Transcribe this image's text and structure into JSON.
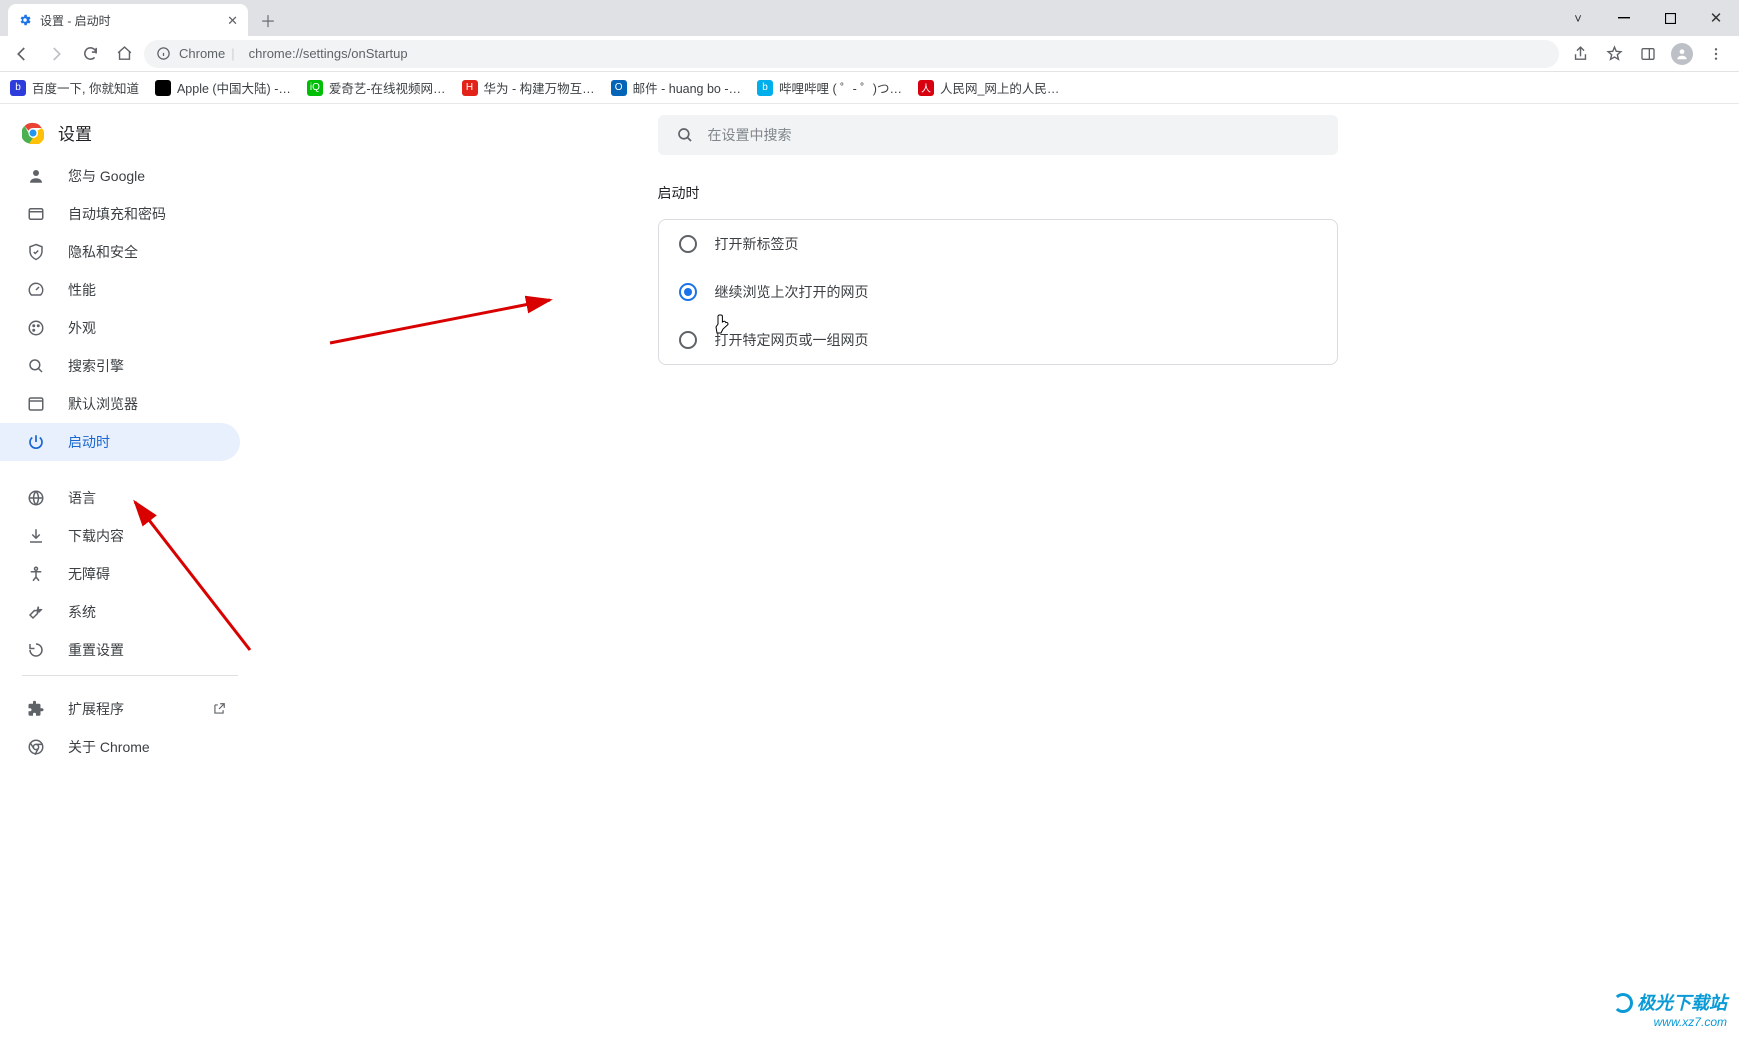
{
  "window": {
    "tab_title": "设置 - 启动时",
    "chrome_label": "Chrome",
    "url": "chrome://settings/onStartup"
  },
  "bookmarks": [
    {
      "label": "百度一下, 你就知道"
    },
    {
      "label": "Apple (中国大陆) -…"
    },
    {
      "label": "爱奇艺-在线视频网…"
    },
    {
      "label": "华为 - 构建万物互…"
    },
    {
      "label": "邮件 - huang bo -…"
    },
    {
      "label": "哔哩哔哩 ( ゜- ゜)つ…"
    },
    {
      "label": "人民网_网上的人民…"
    }
  ],
  "sidebar_title": "设置",
  "search_placeholder": "在设置中搜索",
  "sidebar": [
    {
      "id": "you-and-google",
      "label": "您与 Google",
      "icon": "person"
    },
    {
      "id": "autofill",
      "label": "自动填充和密码",
      "icon": "autofill"
    },
    {
      "id": "privacy",
      "label": "隐私和安全",
      "icon": "shield"
    },
    {
      "id": "performance",
      "label": "性能",
      "icon": "speed"
    },
    {
      "id": "appearance",
      "label": "外观",
      "icon": "palette"
    },
    {
      "id": "search-engine",
      "label": "搜索引擎",
      "icon": "search"
    },
    {
      "id": "default-browser",
      "label": "默认浏览器",
      "icon": "browser"
    },
    {
      "id": "on-startup",
      "label": "启动时",
      "icon": "power",
      "active": true
    },
    {
      "id": "languages",
      "label": "语言",
      "icon": "globe"
    },
    {
      "id": "downloads",
      "label": "下载内容",
      "icon": "download"
    },
    {
      "id": "accessibility",
      "label": "无障碍",
      "icon": "accessibility"
    },
    {
      "id": "system",
      "label": "系统",
      "icon": "wrench"
    },
    {
      "id": "reset",
      "label": "重置设置",
      "icon": "reset"
    }
  ],
  "sidebar_footer": [
    {
      "id": "extensions",
      "label": "扩展程序",
      "icon": "puzzle",
      "external": true
    },
    {
      "id": "about",
      "label": "关于 Chrome",
      "icon": "chrome"
    }
  ],
  "section": {
    "title": "启动时",
    "options": [
      {
        "id": "open-new-tab",
        "label": "打开新标签页",
        "selected": false
      },
      {
        "id": "continue-last",
        "label": "继续浏览上次打开的网页",
        "selected": true
      },
      {
        "id": "open-specific",
        "label": "打开特定网页或一组网页",
        "selected": false
      }
    ]
  },
  "watermark": {
    "line1": "极光下载站",
    "line2": "www.xz7.com"
  }
}
